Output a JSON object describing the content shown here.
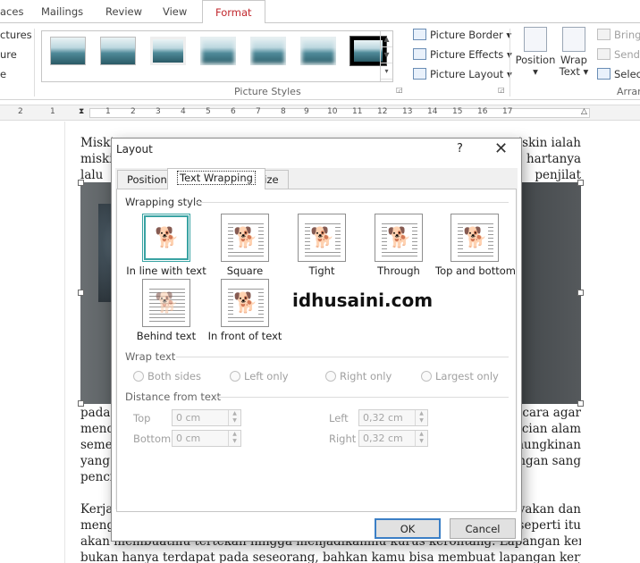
{
  "tabs": [
    "aces",
    "Mailings",
    "Review",
    "View",
    "Format"
  ],
  "ribbon": {
    "left_items": [
      "ctures",
      "ure",
      "e"
    ],
    "picture_styles_label": "Picture Styles",
    "picture_border": "Picture Border",
    "picture_effects": "Picture Effects",
    "picture_layout": "Picture Layout",
    "position": "Position",
    "wrap_text_line1": "Wrap",
    "wrap_text_line2": "Text",
    "bring": "Bring",
    "send": "Send",
    "select": "Select",
    "arrange_label": "Arran"
  },
  "ruler": [
    "2",
    "1",
    "1",
    "2",
    "3",
    "4",
    "5",
    "6",
    "7",
    "8",
    "9",
    "10",
    "11",
    "12",
    "13",
    "14",
    "15",
    "16",
    "17"
  ],
  "document": {
    "top_lines": [
      {
        "left": "Miskin",
        "right": "miskin ialah"
      },
      {
        "left": "miski",
        "right": "hartanya"
      },
      {
        "left": "lalu",
        "right": "penjilat"
      }
    ],
    "mid_lines": [
      {
        "left": "pada",
        "right": "cara agar"
      },
      {
        "left": "mend",
        "right": "ncian alam"
      },
      {
        "left": "seme",
        "right": "mungkinan"
      },
      {
        "left": "yang",
        "right": "ngan sang"
      },
      {
        "left": "penci",
        "right": ""
      }
    ],
    "bottom_lines": [
      {
        "left": "Kerja",
        "right": "yakan dan"
      },
      {
        "left": "meng",
        "right": "seperti itu"
      },
      {
        "left": "akan membuatmu tertekan hingga menjadikanmu kurus kerontang. Lapangan kerja",
        "right": ""
      },
      {
        "left": "bukan hanya terdapat pada seseorang, bahkan kamu bisa membuat lapangan kerja",
        "right": ""
      }
    ]
  },
  "dialog": {
    "title": "Layout",
    "help": "?",
    "close": "✕",
    "tabs": [
      "Position",
      "Text Wrapping",
      "Size"
    ],
    "wrapping_style_label": "Wrapping style",
    "wrap_options": [
      "In line with text",
      "Square",
      "Tight",
      "Through",
      "Top and bottom",
      "Behind text",
      "In front of text"
    ],
    "wrap_text_label": "Wrap text",
    "wrap_text_options": [
      "Both sides",
      "Left only",
      "Right only",
      "Largest only"
    ],
    "distance_label": "Distance from text",
    "top_label": "Top",
    "bottom_label": "Bottom",
    "left_label": "Left",
    "right_label": "Right",
    "top_value": "0 cm",
    "bottom_value": "0 cm",
    "left_value": "0,32 cm",
    "right_value": "0,32 cm",
    "ok": "OK",
    "cancel": "Cancel"
  },
  "watermark": "idhusaini.com"
}
